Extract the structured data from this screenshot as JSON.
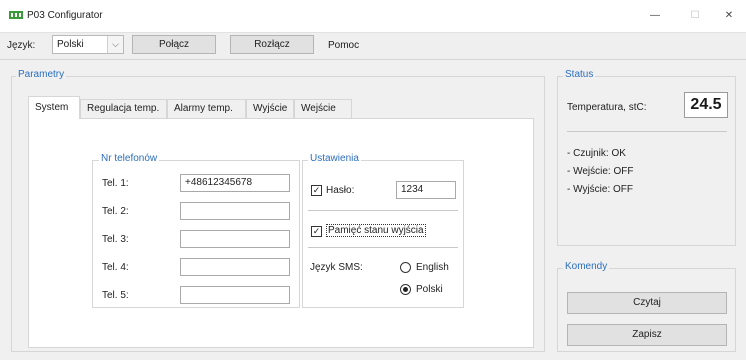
{
  "window": {
    "title": "P03 Configurator",
    "controls": {
      "minimize": "—",
      "maximize": "☐",
      "close": "✕"
    }
  },
  "toolbar": {
    "language_label": "Język:",
    "language_value": "Polski",
    "connect_label": "Połącz",
    "disconnect_label": "Rozłącz",
    "help_label": "Pomoc"
  },
  "parameters": {
    "title": "Parametry",
    "tabs": [
      {
        "label": "System",
        "active": true
      },
      {
        "label": "Regulacja temp.",
        "active": false
      },
      {
        "label": "Alarmy temp.",
        "active": false
      },
      {
        "label": "Wyjście",
        "active": false
      },
      {
        "label": "Wejście",
        "active": false
      }
    ],
    "phones": {
      "title": "Nr telefonów",
      "rows": [
        {
          "label": "Tel. 1:",
          "value": "+48612345678"
        },
        {
          "label": "Tel. 2:",
          "value": ""
        },
        {
          "label": "Tel. 3:",
          "value": ""
        },
        {
          "label": "Tel. 4:",
          "value": ""
        },
        {
          "label": "Tel. 5:",
          "value": ""
        }
      ]
    },
    "settings": {
      "title": "Ustawienia",
      "password_label": "Hasło:",
      "password_checked": true,
      "password_value": "1234",
      "memory_label": "Pamięć stanu wyjścia",
      "memory_checked": true,
      "sms_language_label": "Język SMS:",
      "sms_options": [
        {
          "label": "English",
          "selected": false
        },
        {
          "label": "Polski",
          "selected": true
        }
      ]
    }
  },
  "status": {
    "title": "Status",
    "temperature_label": "Temperatura, stC:",
    "temperature_value": "24.5",
    "lines": [
      "- Czujnik: OK",
      "- Wejście: OFF",
      "- Wyjście: OFF"
    ]
  },
  "commands": {
    "title": "Komendy",
    "read_label": "Czytaj",
    "write_label": "Zapisz"
  },
  "colors": {
    "accent": "#2c6fbf",
    "panel": "#f0f0f0",
    "app_icon": "#3a9a3a"
  }
}
